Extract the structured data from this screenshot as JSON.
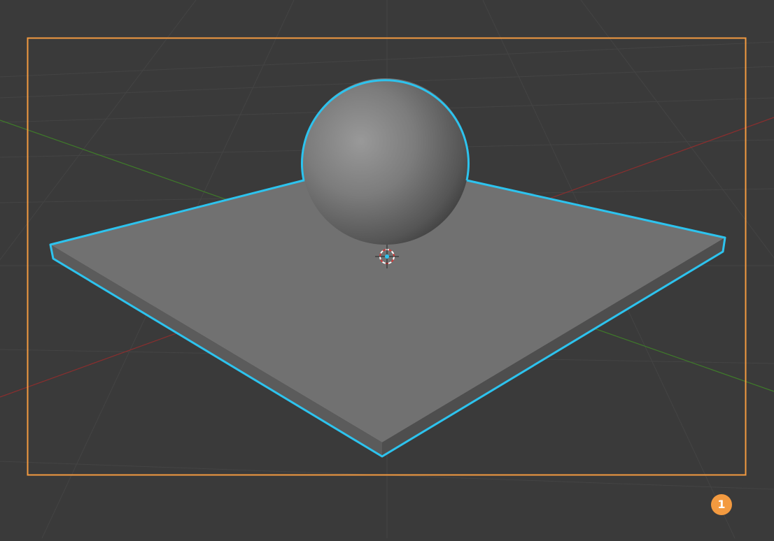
{
  "viewport": {
    "background_color": "#3a3a3a",
    "grid_color": "#444444",
    "x_axis_color": "#8a2e2e",
    "y_axis_color": "#3f7a2a",
    "selection_outline_color": "#2dc3ee",
    "camera_frame_color": "#f39a40"
  },
  "objects": [
    {
      "name": "Sphere",
      "color": "#8a8a8a"
    },
    {
      "name": "Plane",
      "color": "#707070"
    }
  ],
  "cursor_icon": "3d-cursor-icon",
  "badge": {
    "label": "1",
    "color": "#f39a40"
  }
}
